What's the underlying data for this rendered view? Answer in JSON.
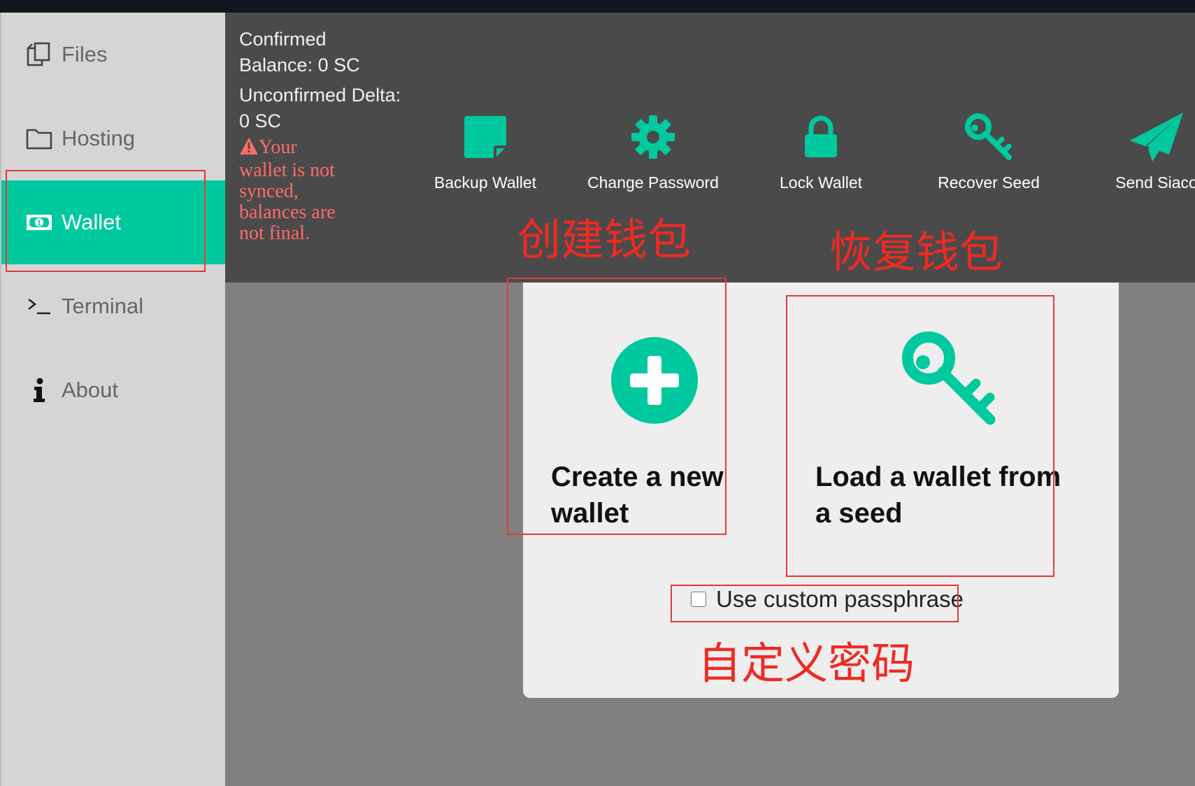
{
  "sidebar": {
    "items": [
      {
        "label": "Files",
        "icon": "files-icon",
        "active": false
      },
      {
        "label": "Hosting",
        "icon": "folder-icon",
        "active": false
      },
      {
        "label": "Wallet",
        "icon": "money-icon",
        "active": true
      },
      {
        "label": "Terminal",
        "icon": "terminal-icon",
        "active": false
      },
      {
        "label": "About",
        "icon": "info-icon",
        "active": false
      }
    ]
  },
  "header": {
    "confirmed_label": "Confirmed",
    "confirmed_balance": "Balance: 0 SC",
    "unconfirmed_label": "Unconfirmed Delta:",
    "unconfirmed_value": "0 SC",
    "warning": "Your wallet is not synced, balances are not final.",
    "toolbar": [
      {
        "label": "Backup Wallet",
        "icon": "backup-icon"
      },
      {
        "label": "Change Password",
        "icon": "gear-icon"
      },
      {
        "label": "Lock Wallet",
        "icon": "lock-icon"
      },
      {
        "label": "Recover Seed",
        "icon": "key-icon"
      },
      {
        "label": "Send Siaco",
        "icon": "paper-plane-icon"
      }
    ]
  },
  "main": {
    "create_wallet": "Create a new wallet",
    "load_wallet": "Load a wallet from a seed",
    "custom_passphrase": "Use custom passphrase"
  },
  "annotations": {
    "create": "创建钱包",
    "recover": "恢复钱包",
    "custom_password": "自定义密码"
  },
  "colors": {
    "accent": "#00c99f",
    "header_bg": "#4a4a4a",
    "sidebar_bg": "#d5d5d5",
    "warning": "#ff6a6a",
    "annotation": "#e53935"
  }
}
